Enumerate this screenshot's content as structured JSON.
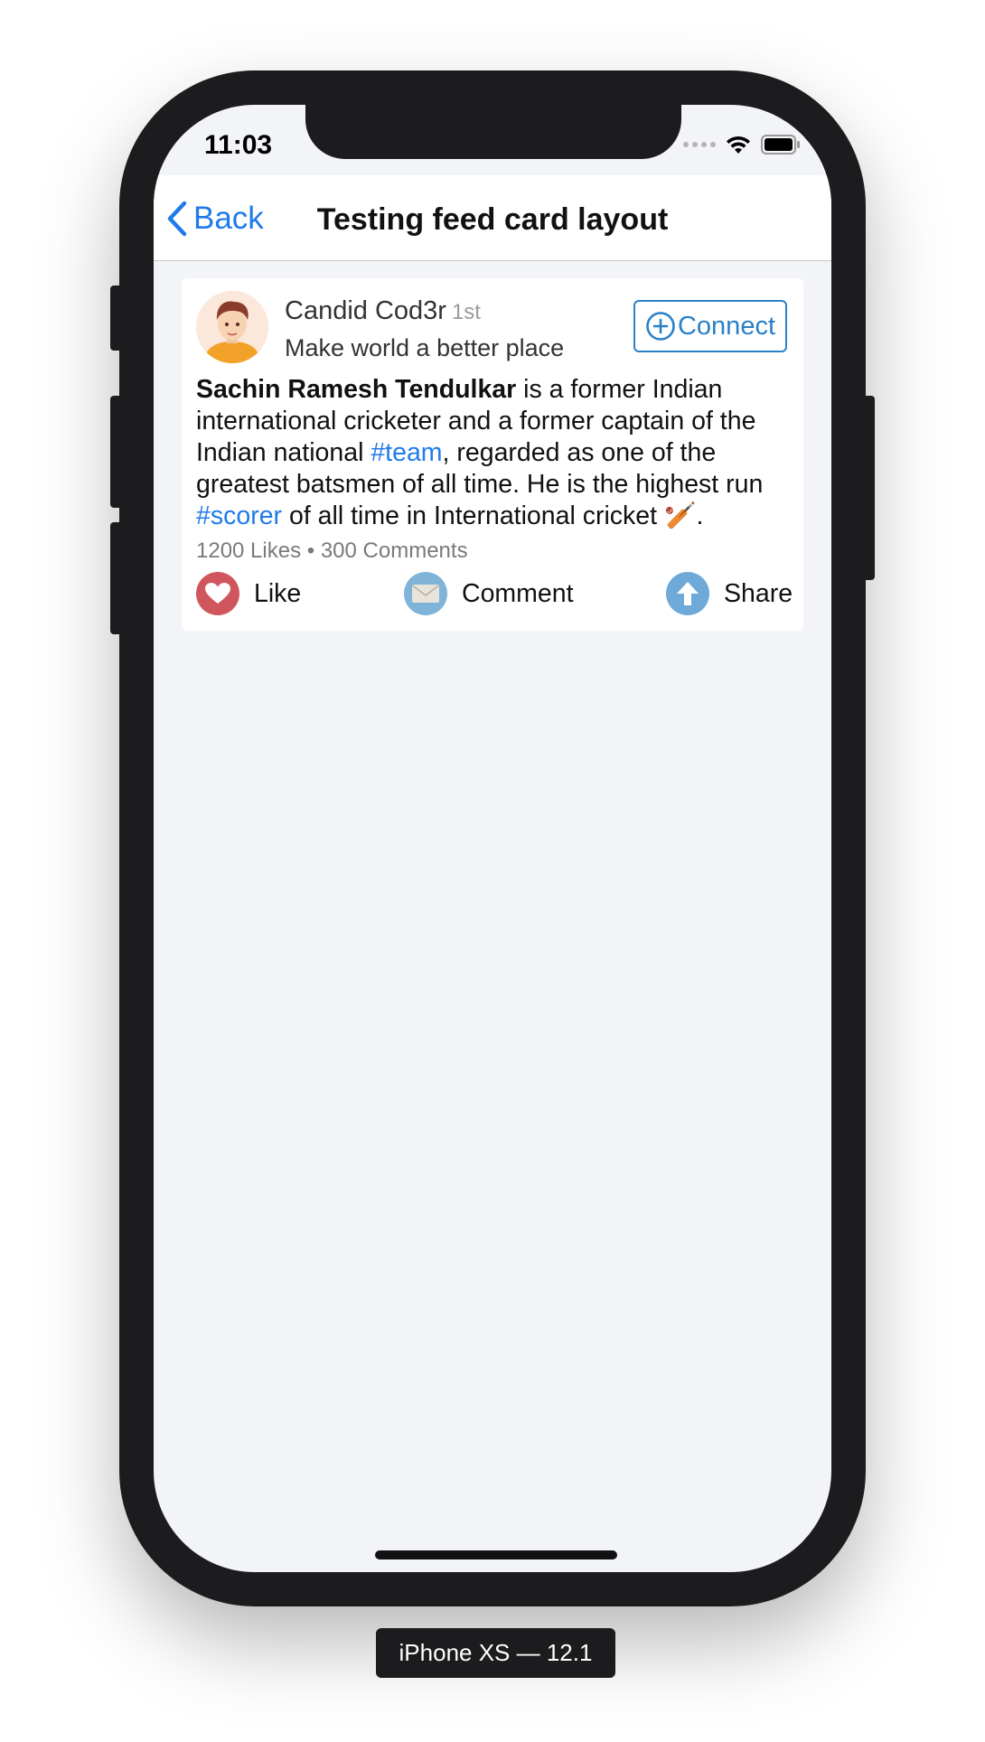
{
  "status_bar": {
    "time": "11:03"
  },
  "nav": {
    "back_label": "Back",
    "title": "Testing feed card layout"
  },
  "card": {
    "author_name": "Candid Cod3r",
    "degree": "1st",
    "headline": "Make world a better place",
    "connect_label": "Connect",
    "post": {
      "bold": "Sachin Ramesh Tendulkar",
      "part1": " is a former Indian international cricketer and a former captain of the Indian national ",
      "hashtag1": "#team",
      "part2": ", regarded as one of the greatest batsmen of all time. He is the highest run ",
      "hashtag2": "#scorer",
      "part3": " of all time in International cricket ",
      "emoji": "🏏",
      "part4": "."
    },
    "stats": "1200 Likes • 300 Comments",
    "actions": {
      "like": "Like",
      "comment": "Comment",
      "share": "Share"
    }
  },
  "device_label": "iPhone XS — 12.1",
  "colors": {
    "accent": "#1f7bea",
    "like": "#d0565d",
    "comment": "#7fb3d8",
    "share": "#6ea9d8"
  },
  "icons": [
    "back-chevron-icon",
    "plus-circle-icon",
    "heart-icon",
    "envelope-icon",
    "arrow-up-icon",
    "cricket-bat-icon"
  ]
}
